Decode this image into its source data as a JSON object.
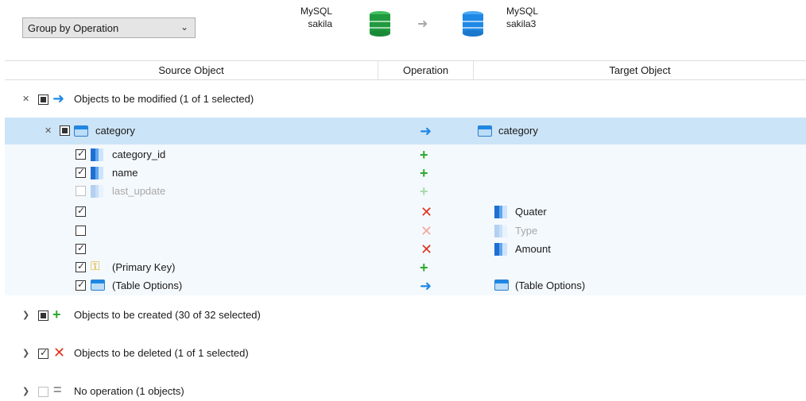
{
  "toolbar": {
    "group_by": "Group by Operation",
    "source_engine": "MySQL",
    "source_schema": "sakila",
    "target_engine": "MySQL",
    "target_schema": "sakila3"
  },
  "columns": {
    "source": "Source Object",
    "operation": "Operation",
    "target": "Target Object"
  },
  "groups": {
    "modified": "Objects to be modified (1 of 1 selected)",
    "created": "Objects to be created (30 of 32 selected)",
    "deleted": "Objects to be deleted (1 of 1 selected)",
    "noop": "No operation (1 objects)"
  },
  "table": {
    "source": "category",
    "target": "category"
  },
  "items": [
    {
      "source": "category_id",
      "target": ""
    },
    {
      "source": "name",
      "target": ""
    },
    {
      "source": "last_update",
      "target": ""
    },
    {
      "source": "",
      "target": "Quater"
    },
    {
      "source": "",
      "target": "Type"
    },
    {
      "source": "",
      "target": "Amount"
    },
    {
      "source": "(Primary Key)",
      "target": ""
    },
    {
      "source": "(Table Options)",
      "target": "(Table Options)"
    }
  ],
  "colors": {
    "selected_row": "#cce4f7",
    "add": "#2da82d",
    "delete": "#e0331e",
    "modify": "#1e88e5"
  }
}
